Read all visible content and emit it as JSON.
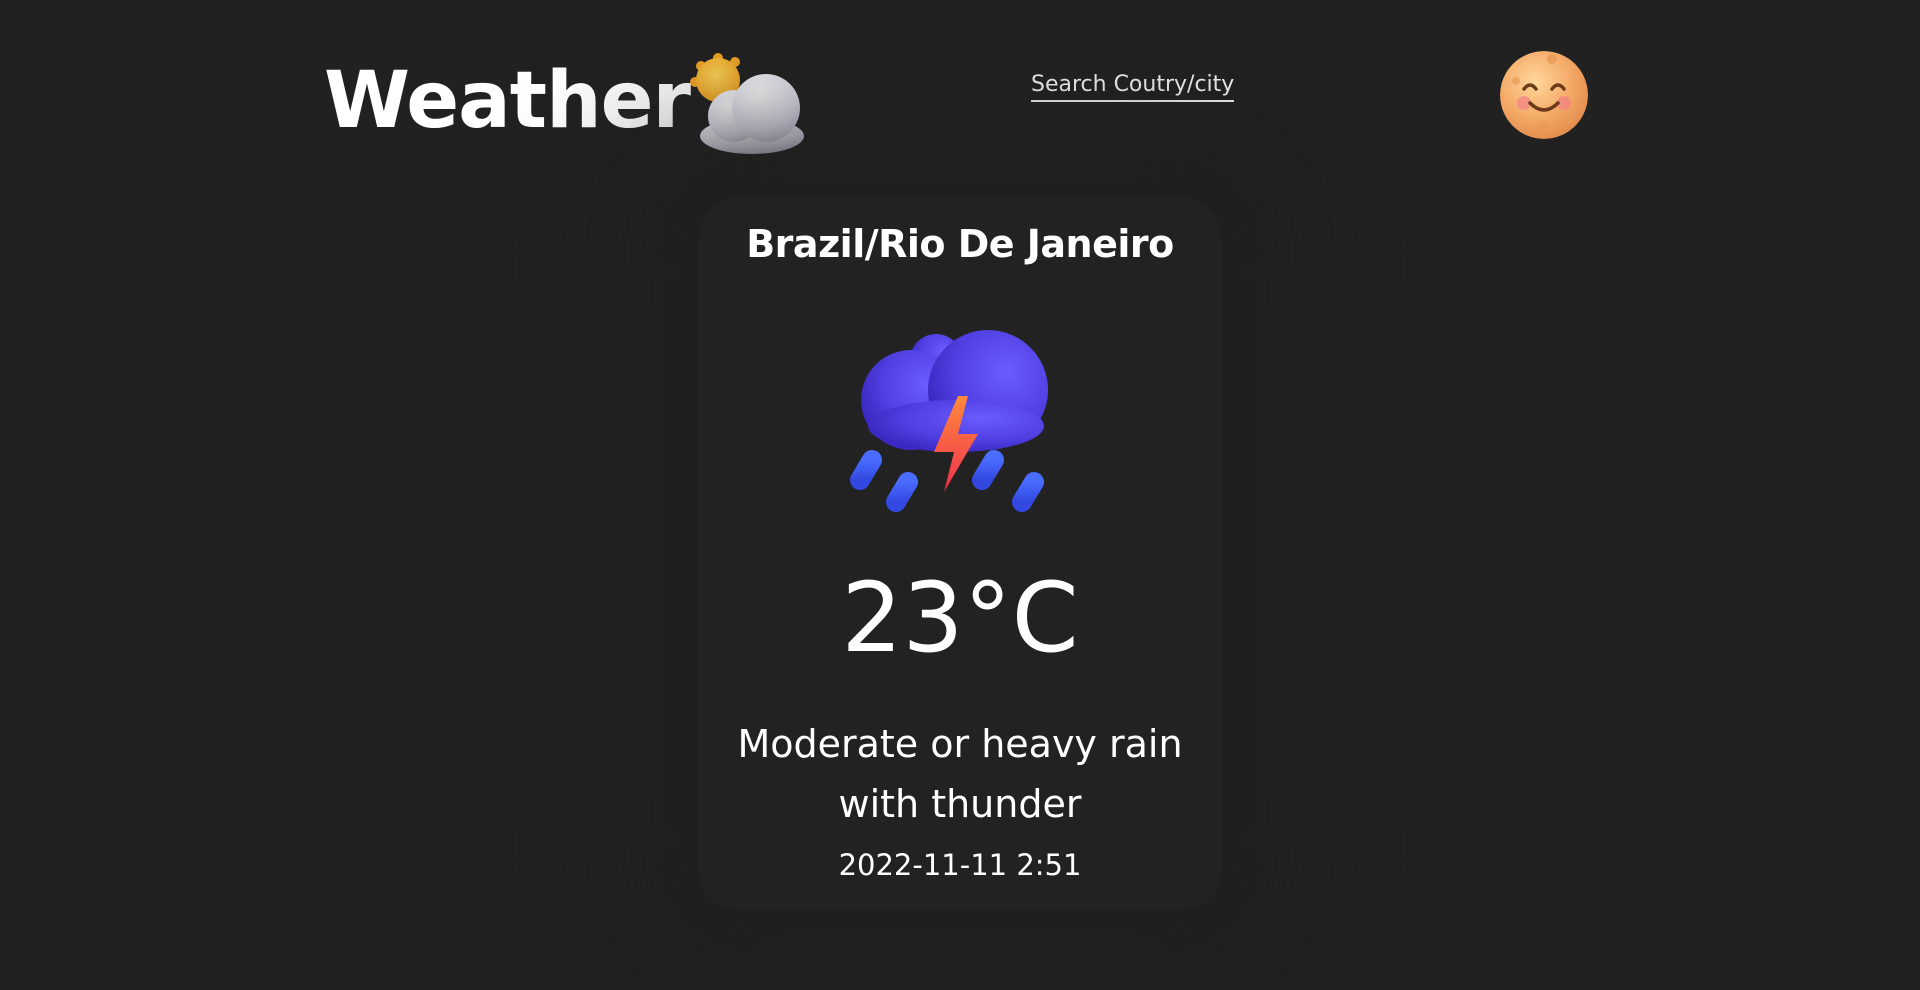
{
  "header": {
    "logo_text": "Weather",
    "logo_icon": "sun-behind-cloud-icon",
    "search_label": "Search Coutry/city",
    "avatar_icon": "smiling-moon-face-icon"
  },
  "card": {
    "location": "Brazil/Rio De Janeiro",
    "weather_icon": "cloud-with-lightning-and-rain-icon",
    "temperature": "23°C",
    "condition": "Moderate or heavy rain with thunder",
    "timestamp": "2022-11-11 2:51"
  },
  "colors": {
    "background": "#212121",
    "card": "#222222",
    "text": "#ffffff",
    "cloud": "#5a4ef0",
    "rain": "#3f5cf5",
    "lightning": "#f2564a"
  }
}
